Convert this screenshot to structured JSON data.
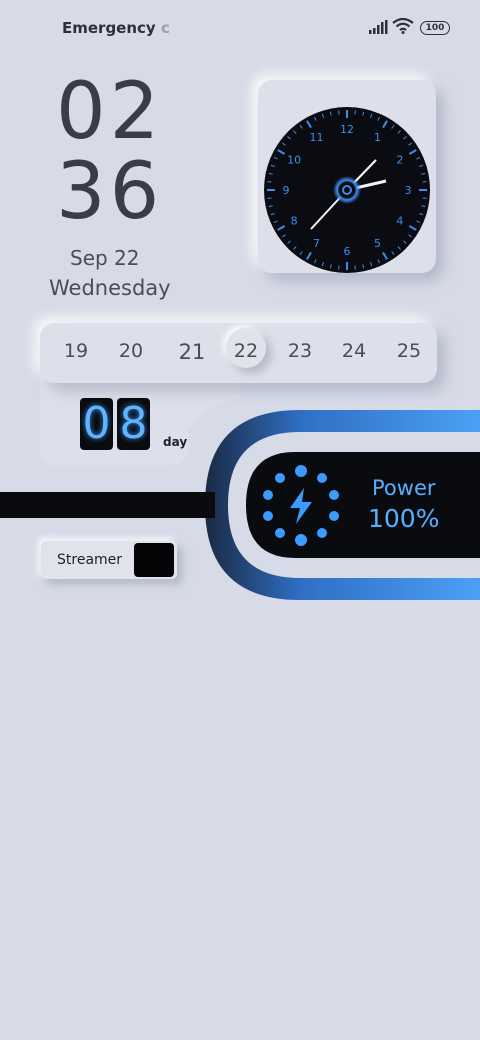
{
  "status_bar": {
    "carrier": "Emergency",
    "carrier_fade": "c",
    "battery_level": "100",
    "icons": [
      "signal-icon",
      "wifi-icon",
      "battery-icon"
    ]
  },
  "clock": {
    "hours": "02",
    "minutes": "36",
    "date": "Sep 22",
    "weekday": "Wednesday"
  },
  "analog_clock": {
    "numerals": [
      "12",
      "1",
      "2",
      "3",
      "4",
      "5",
      "6",
      "7",
      "8",
      "9",
      "10",
      "11"
    ],
    "accent": "#3b8df0"
  },
  "calendar": {
    "days": [
      "19",
      "20",
      "21",
      "22",
      "23",
      "24",
      "25"
    ],
    "selected": "22"
  },
  "day_counter": {
    "digits": [
      "0",
      "8"
    ],
    "label": "day"
  },
  "power": {
    "label": "Power",
    "value": "100%",
    "icon": "lightning-bolt-icon",
    "accent": "#56b0ff"
  },
  "streamer": {
    "label": "Streamer"
  }
}
